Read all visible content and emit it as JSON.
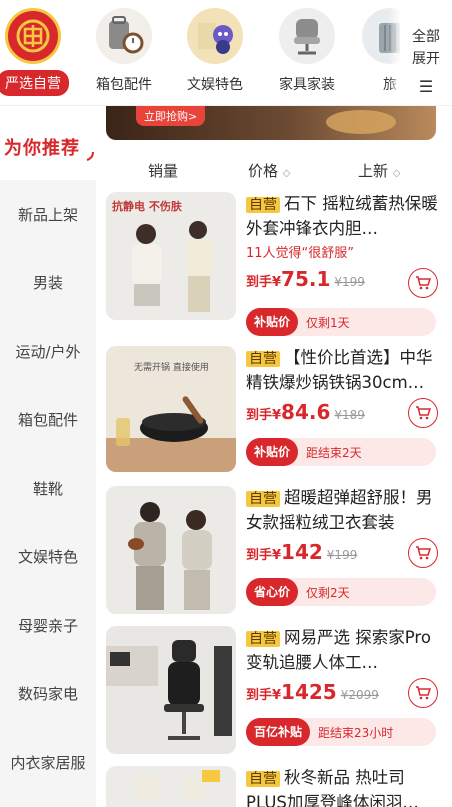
{
  "categories": [
    {
      "label": "严选自营",
      "icon": "yanxuan-logo-icon",
      "active": true
    },
    {
      "label": "箱包配件",
      "icon": "bag-watch-icon"
    },
    {
      "label": "文娱特色",
      "icon": "doll-icon"
    },
    {
      "label": "家具家装",
      "icon": "chair-icon"
    },
    {
      "label": "旅",
      "icon": "luggage-icon"
    }
  ],
  "expand": {
    "line1": "全部",
    "line2": "展开"
  },
  "sidebar": {
    "heading": "为你推荐",
    "items": [
      "新品上架",
      "男装",
      "运动/户外",
      "箱包配件",
      "鞋靴",
      "文娱特色",
      "母婴亲子",
      "数码家电",
      "内衣家居服"
    ]
  },
  "banner": {
    "tag": "立即抢购>"
  },
  "sort": {
    "sales": "销量",
    "price": "价格",
    "new": "上新"
  },
  "products": [
    {
      "self_tag": "自营",
      "title": "石下 摇粒绒蓄热保暖外套冲锋衣内胆…",
      "social": "11人觉得“很舒服”",
      "price_prefix": "到手¥",
      "price": "75.1",
      "orig": "¥199",
      "promo_tag": "补贴价",
      "promo_text": "仅剩1天",
      "img_text": "抗静电 不伤肤"
    },
    {
      "self_tag": "自营",
      "title": "【性价比首选】中华精铁爆炒锅铁锅30cm…",
      "price_prefix": "到手¥",
      "price": "84.6",
      "orig": "¥189",
      "promo_tag": "补贴价",
      "promo_text": "距结束2天",
      "img_text": "无需开锅 直接使用"
    },
    {
      "self_tag": "自营",
      "title": "超暖超弹超舒服！男女款摇粒绒卫衣套装",
      "price_prefix": "到手¥",
      "price": "142",
      "orig": "¥199",
      "promo_tag": "省心价",
      "promo_text": "仅剩2天"
    },
    {
      "self_tag": "自营",
      "title": "网易严选 探索家Pro变轨追腰人体工…",
      "price_prefix": "到手¥",
      "price": "1425",
      "orig": "¥2099",
      "promo_tag": "百亿补贴",
      "promo_text": "距结束23小时"
    },
    {
      "self_tag": "自营",
      "title": "秋冬新品 热吐司PLUS加厚登峰体闲羽…"
    }
  ],
  "colors": {
    "brand_red": "#d8282c",
    "self_yellow": "#f6c842"
  }
}
